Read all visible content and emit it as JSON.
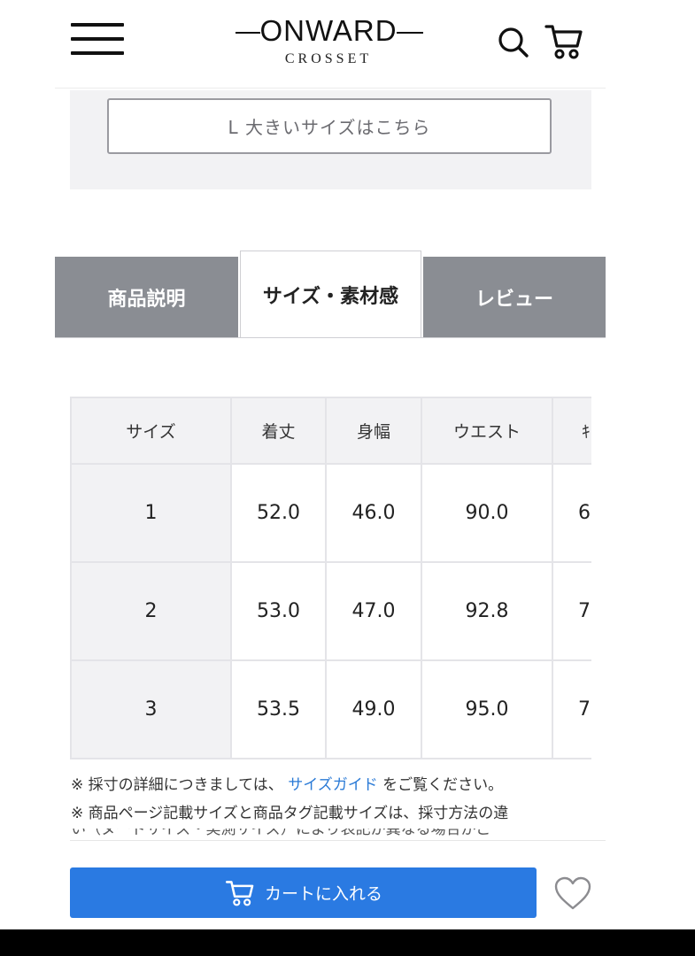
{
  "header": {
    "logo_main": "ONWARD",
    "logo_sub": "CROSSET",
    "icons": [
      "hamburger-menu-icon",
      "search-icon",
      "cart-icon"
    ]
  },
  "size_link": {
    "label": "L 大きいサイズはこちら"
  },
  "tabs": [
    {
      "label": "商品説明",
      "active": false
    },
    {
      "label": "サイズ・素材感",
      "active": true
    },
    {
      "label": "レビュー",
      "active": false
    }
  ],
  "size_table": {
    "headers": [
      "サイズ",
      "着丈",
      "身幅",
      "ウエスト",
      "ｷ"
    ],
    "rows": [
      [
        "1",
        "52.0",
        "46.0",
        "90.0",
        "6"
      ],
      [
        "2",
        "53.0",
        "47.0",
        "92.8",
        "7"
      ],
      [
        "3",
        "53.5",
        "49.0",
        "95.0",
        "7"
      ]
    ]
  },
  "notes": {
    "line1_prefix": "※ 採寸の詳細につきましては、",
    "line1_link": "サイズガイド",
    "line1_suffix": "をご覧ください。",
    "line2": "※ 商品ページ記載サイズと商品タグ記載サイズは、採寸方法の違",
    "line3_cut": "い（ヌードサイズ・実測サイズ）により表記が異なる場合がご"
  },
  "bottom_bar": {
    "cart_label": "カートに入れる",
    "favorite_icon": "heart-icon"
  },
  "colors": {
    "accent_blue": "#2a7ae2",
    "link_blue": "#2a7ad6",
    "tab_gray": "#8a8d93",
    "panel_gray": "#f2f2f4"
  }
}
